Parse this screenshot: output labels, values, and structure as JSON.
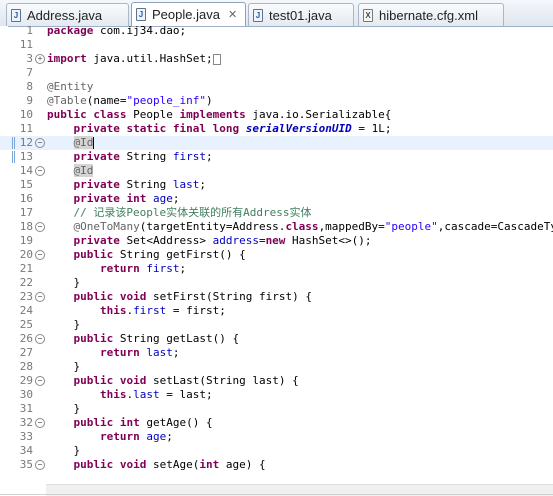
{
  "tabs": [
    {
      "label": "Address.java",
      "icon": "java-file-icon",
      "active": false
    },
    {
      "label": "People.java",
      "icon": "java-file-icon",
      "active": true
    },
    {
      "label": "test01.java",
      "icon": "java-file-icon",
      "active": false
    },
    {
      "label": "hibernate.cfg.xml",
      "icon": "xml-file-icon",
      "active": false
    }
  ],
  "tab_close": "✕",
  "icon_glyphs": {
    "java": "J",
    "xml": "X"
  },
  "colors": {
    "keyword": "#7f0055",
    "annotation": "#646464",
    "comment": "#3f7f5f",
    "string": "#2a00ff",
    "field": "#0000c0"
  },
  "editor": {
    "lines": [
      {
        "n": "1",
        "text": "package com.ij34.dao;"
      },
      {
        "n": "11",
        "text": ""
      },
      {
        "n": "3",
        "text": "import java.util.HashSet;"
      },
      {
        "n": "7",
        "text": ""
      },
      {
        "n": "8",
        "text": "@Entity"
      },
      {
        "n": "9",
        "text": "@Table(name=\"people_inf\")"
      },
      {
        "n": "10",
        "text": "public class People implements java.io.Serializable{"
      },
      {
        "n": "11",
        "text": "private static final long serialVersionUID = 1L;"
      },
      {
        "n": "12",
        "text": "@Id"
      },
      {
        "n": "13",
        "text": "private String first;"
      },
      {
        "n": "14",
        "text": "@Id"
      },
      {
        "n": "15",
        "text": "private String last;"
      },
      {
        "n": "16",
        "text": "private int age;"
      },
      {
        "n": "17",
        "text": "// 记录该People实体关联的所有Address实体"
      },
      {
        "n": "18",
        "text": "@OneToMany(targetEntity=Address.class,mappedBy=\"people\",cascade=CascadeType.ALL)"
      },
      {
        "n": "19",
        "text": "private Set<Address> address=new HashSet<>();"
      },
      {
        "n": "20",
        "text": "public String getFirst() {"
      },
      {
        "n": "21",
        "text": "return first;"
      },
      {
        "n": "22",
        "text": "}"
      },
      {
        "n": "23",
        "text": "public void setFirst(String first) {"
      },
      {
        "n": "24",
        "text": "this.first = first;"
      },
      {
        "n": "25",
        "text": "}"
      },
      {
        "n": "26",
        "text": "public String getLast() {"
      },
      {
        "n": "27",
        "text": "return last;"
      },
      {
        "n": "28",
        "text": "}"
      },
      {
        "n": "29",
        "text": "public void setLast(String last) {"
      },
      {
        "n": "30",
        "text": "this.last = last;"
      },
      {
        "n": "31",
        "text": "}"
      },
      {
        "n": "32",
        "text": "public int getAge() {"
      },
      {
        "n": "33",
        "text": "return age;"
      },
      {
        "n": "34",
        "text": "}"
      },
      {
        "n": "35",
        "text": "public void setAge(int age) {"
      }
    ]
  }
}
